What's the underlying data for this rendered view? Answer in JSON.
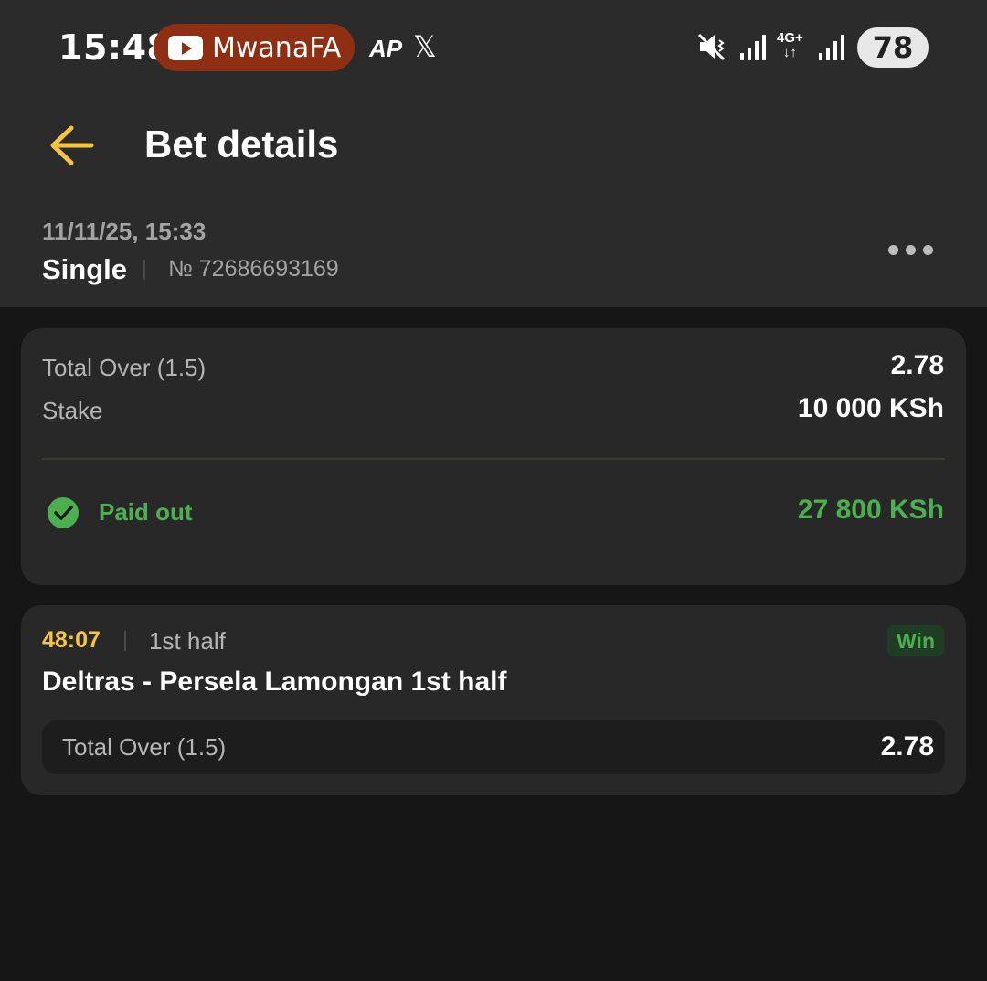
{
  "status_bar": {
    "time": "15:48",
    "notification_app": "MwanaFA",
    "ap_label": "AP",
    "x_label": "𝕏",
    "network_type": "4G+",
    "battery": "78"
  },
  "header": {
    "title": "Bet details"
  },
  "bet": {
    "date": "11/11/25, 15:33",
    "type": "Single",
    "number": "№ 72686693169"
  },
  "summary": {
    "market_label": "Total Over (1.5)",
    "market_odds": "2.78",
    "stake_label": "Stake",
    "stake_value": "10 000 KSh",
    "status_label": "Paid out",
    "payout": "27 800 KSh"
  },
  "event": {
    "time": "48:07",
    "period": "1st half",
    "result_badge": "Win",
    "match": "Deltras - Persela Lamongan 1st half",
    "outcome_label": "Total Over (1.5)",
    "outcome_odds": "2.78"
  },
  "colors": {
    "accent": "#f5c542",
    "success": "#4caf50",
    "background": "#161616",
    "header_bg": "#2b2b2b",
    "card_bg": "#282828"
  }
}
